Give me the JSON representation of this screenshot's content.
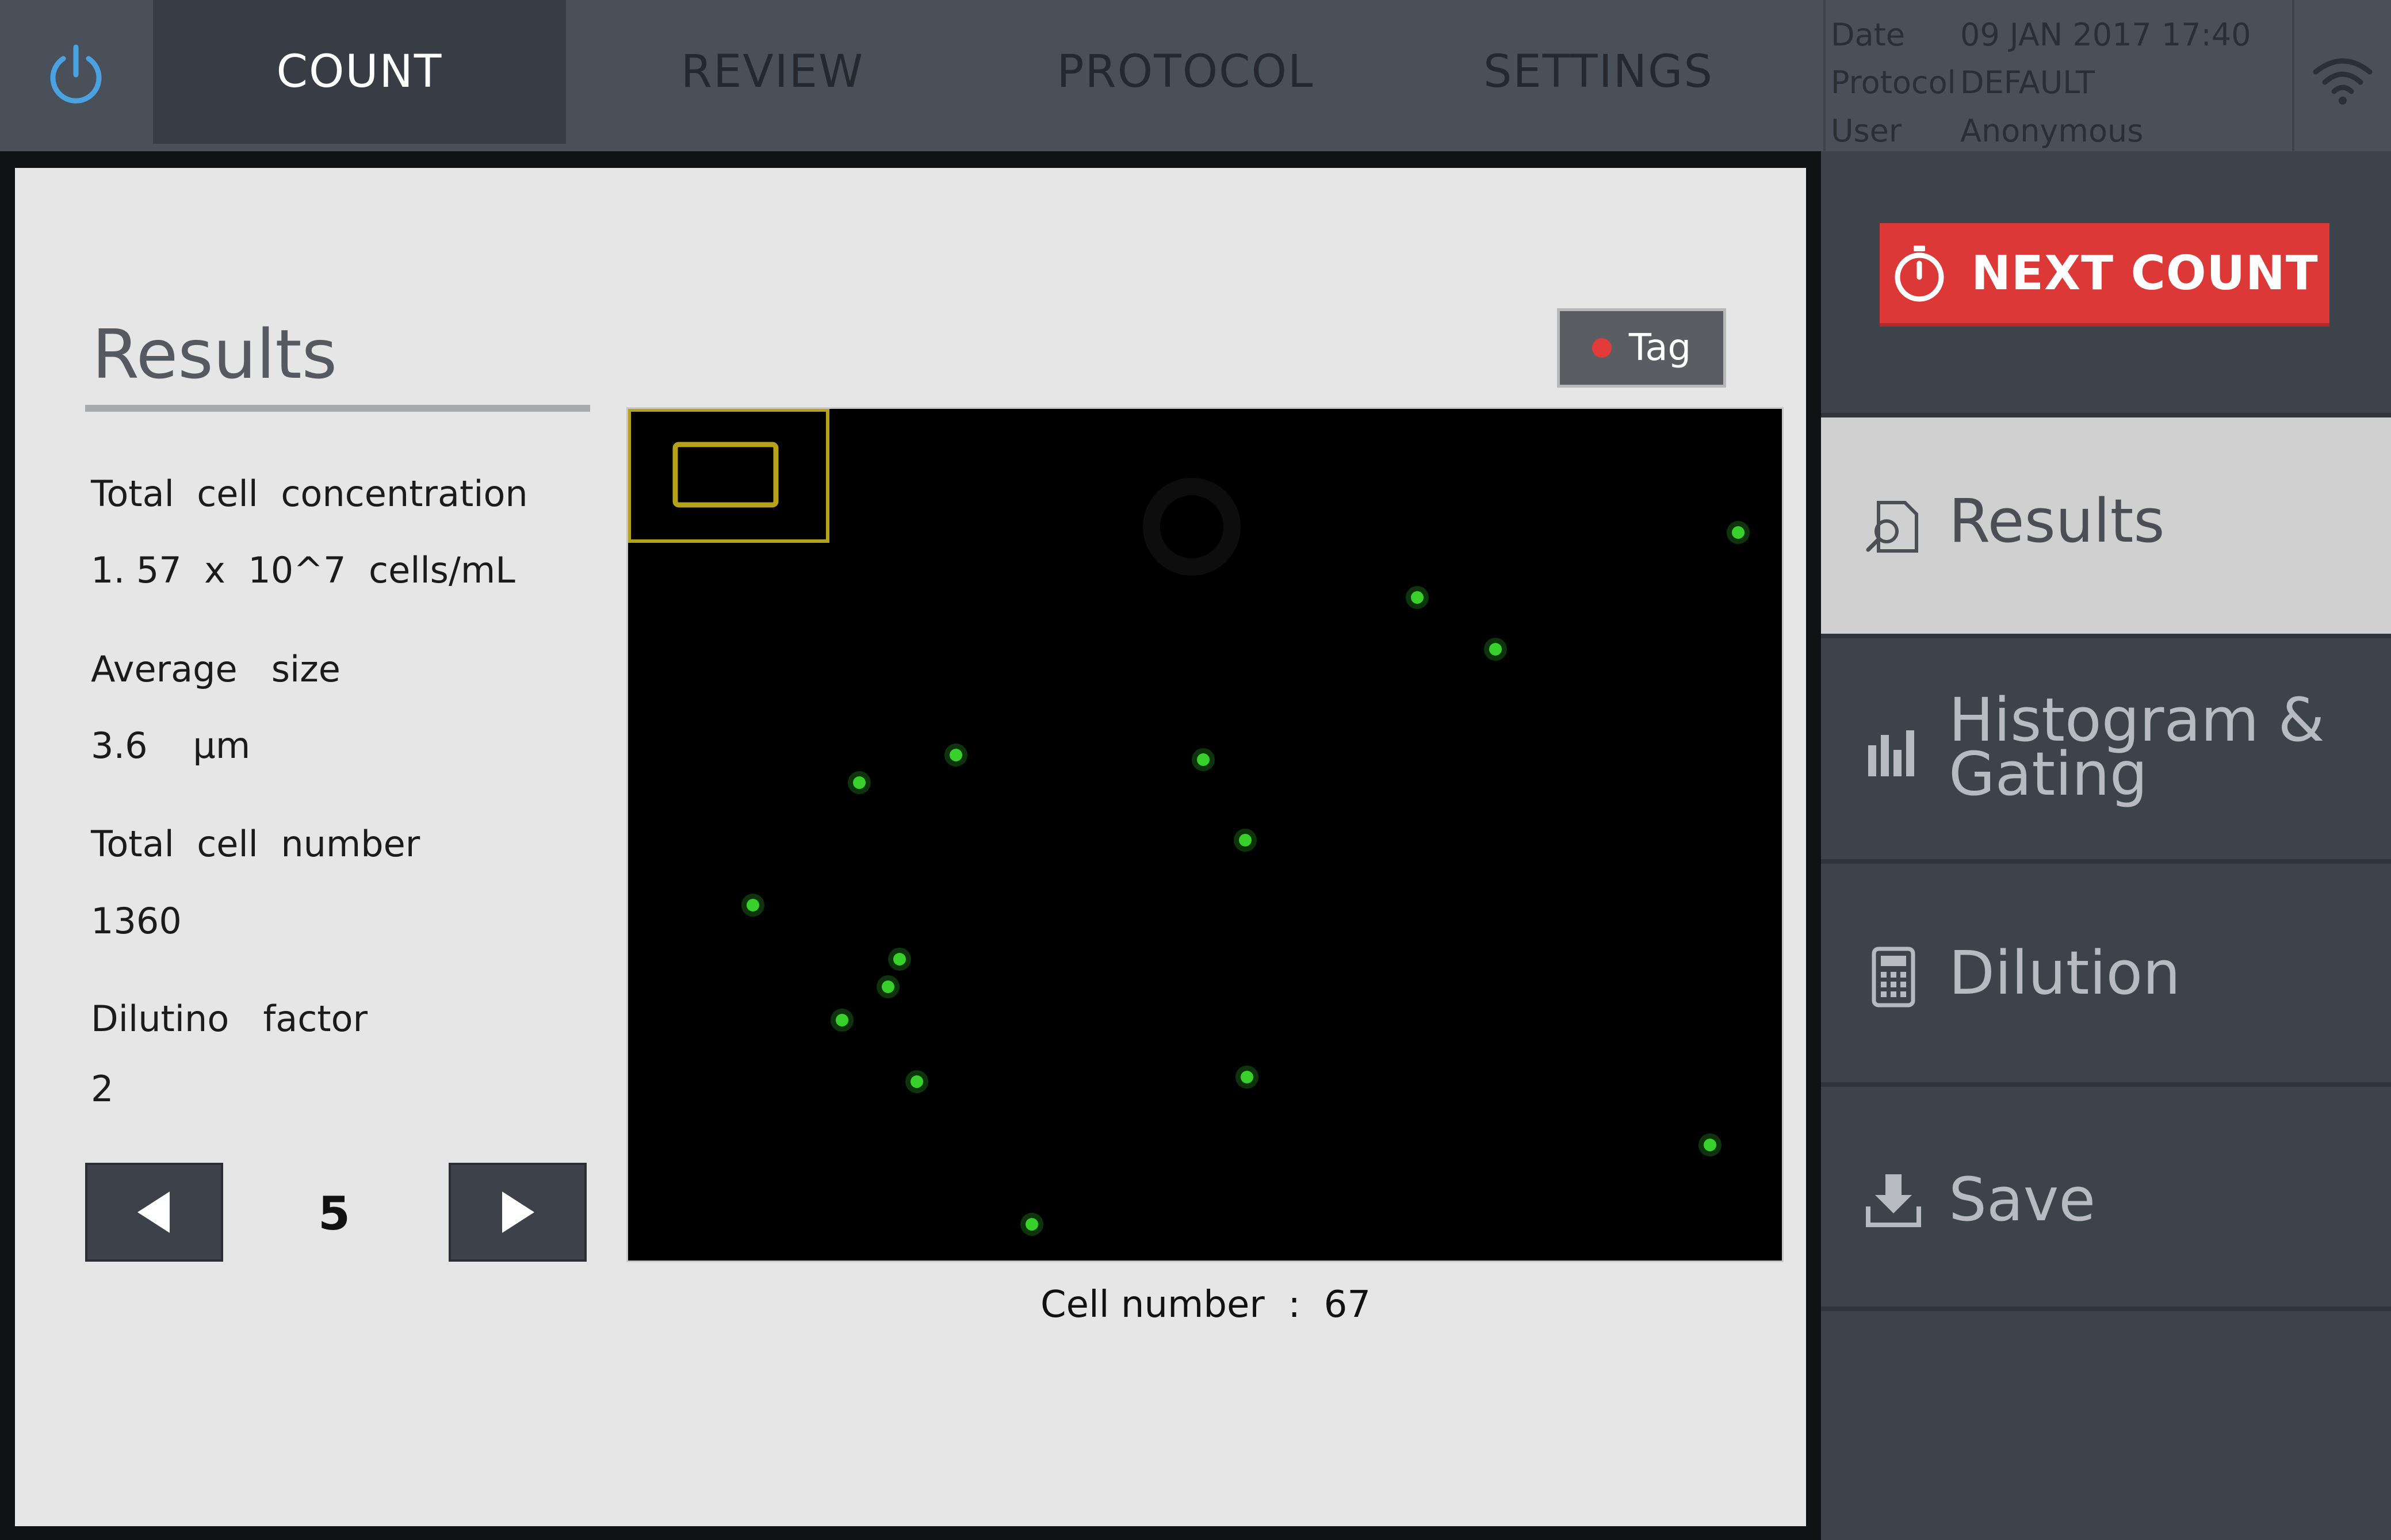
{
  "header": {
    "power_icon": "power-icon",
    "tabs": [
      {
        "label": "COUNT",
        "active": true
      },
      {
        "label": "REVIEW",
        "active": false
      },
      {
        "label": "PROTOCOL",
        "active": false
      },
      {
        "label": "SETTINGS",
        "active": false
      }
    ],
    "info": {
      "date_label": "Date",
      "date_value": "09 JAN 2017 17:40",
      "protocol_label": "Protocol",
      "protocol_value": "DEFAULT",
      "user_label": "User",
      "user_value": "Anonymous"
    },
    "wifi_icon": "wifi-icon"
  },
  "results": {
    "title": "Results",
    "total_cell_concentration_label": "Total  cell  concentration",
    "total_cell_concentration_value": "1. 57  x  10^7  cells/mL",
    "average_size_label": "Average   size",
    "average_size_value": "3.6    µm",
    "total_cell_number_label": "Total  cell  number",
    "total_cell_number_value": "1360",
    "dilution_factor_label": "Dilutino   factor",
    "dilution_factor_value": "2",
    "page_number": "5"
  },
  "image_view": {
    "tag_label": "Tag",
    "cell_number_caption": "Cell number  :  67",
    "cell_color": "#39d12b",
    "roi_color": "#b6a21a"
  },
  "sidebar": {
    "next_count_label": "NEXT COUNT",
    "items": [
      {
        "label": "Results",
        "icon": "results-icon",
        "active": true
      },
      {
        "label_line1": "Histogram &",
        "label_line2": "Gating",
        "icon": "histogram-icon",
        "active": false
      },
      {
        "label": "Dilution",
        "icon": "calculator-icon",
        "active": false
      },
      {
        "label": "Save",
        "icon": "download-icon",
        "active": false
      }
    ]
  },
  "colors": {
    "accent_red": "#dc3837",
    "topbar": "#4a505a",
    "active_tab": "#373c45",
    "sidebar": "#3d434b",
    "panel": "#e6e6e6"
  }
}
